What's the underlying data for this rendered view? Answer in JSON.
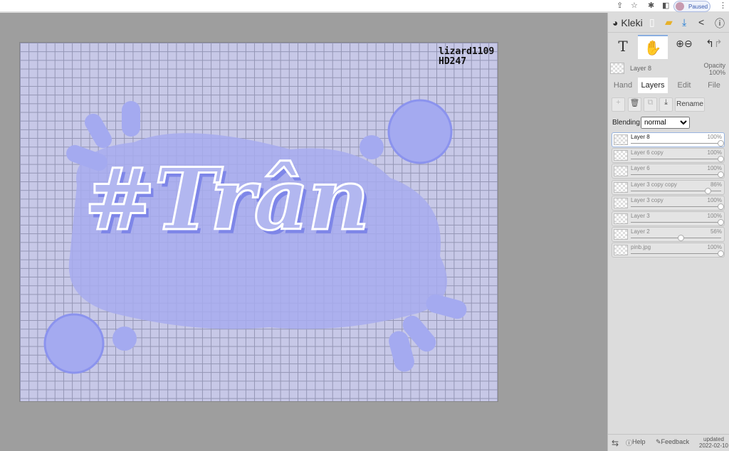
{
  "browser": {
    "profile_status": "Paused"
  },
  "canvas": {
    "artwork_text": "#Trân",
    "watermark_line1": "lizard1109",
    "watermark_line2": "HD247"
  },
  "panel": {
    "logo": "Kleki",
    "current_layer": "Layer 8",
    "opacity_label": "Opacity",
    "opacity_value": "100%",
    "tabs": [
      "Hand",
      "Layers",
      "Edit",
      "File"
    ],
    "rename_label": "Rename",
    "blending_label": "Blending",
    "blending_value": "normal",
    "layers": [
      {
        "name": "Layer 8",
        "opacity": "100%",
        "value": 100
      },
      {
        "name": "Layer 6 copy",
        "opacity": "100%",
        "value": 100
      },
      {
        "name": "Layer 6",
        "opacity": "100%",
        "value": 100
      },
      {
        "name": "Layer 3 copy copy",
        "opacity": "86%",
        "value": 86
      },
      {
        "name": "Layer 3 copy",
        "opacity": "100%",
        "value": 100
      },
      {
        "name": "Layer 3",
        "opacity": "100%",
        "value": 100
      },
      {
        "name": "Layer 2",
        "opacity": "56%",
        "value": 56
      },
      {
        "name": "pinb.jpg",
        "opacity": "100%",
        "value": 100
      }
    ],
    "footer": {
      "help": "Help",
      "feedback": "Feedback",
      "updated_label": "updated",
      "updated_date": "2022-02-10"
    }
  }
}
